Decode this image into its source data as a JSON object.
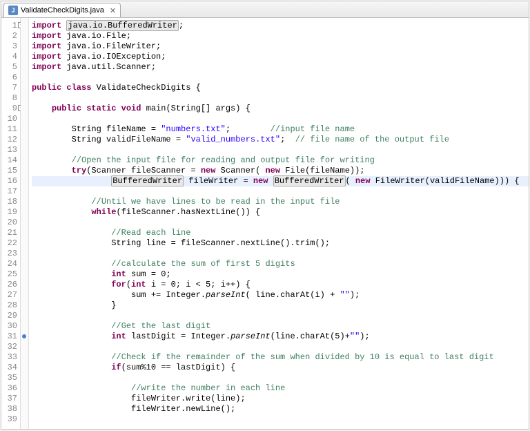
{
  "tab": {
    "icon_letter": "J",
    "title": "ValidateCheckDigits.java",
    "close": "✕"
  },
  "gutter": {
    "start": 1,
    "end": 39,
    "folds": [
      1,
      9
    ],
    "markers_blue": [
      31
    ]
  },
  "code": [
    {
      "n": 1,
      "seg": [
        {
          "c": "kw",
          "t": "import"
        },
        {
          "t": " "
        },
        {
          "c": "sel-box",
          "t": "java.io.BufferedWriter"
        },
        {
          "t": ";"
        }
      ]
    },
    {
      "n": 2,
      "seg": [
        {
          "c": "kw",
          "t": "import"
        },
        {
          "t": " java.io.File;"
        }
      ]
    },
    {
      "n": 3,
      "seg": [
        {
          "c": "kw",
          "t": "import"
        },
        {
          "t": " java.io.FileWriter;"
        }
      ]
    },
    {
      "n": 4,
      "seg": [
        {
          "c": "kw",
          "t": "import"
        },
        {
          "t": " java.io.IOException;"
        }
      ]
    },
    {
      "n": 5,
      "seg": [
        {
          "c": "kw",
          "t": "import"
        },
        {
          "t": " java.util.Scanner;"
        }
      ]
    },
    {
      "n": 6,
      "seg": [
        {
          "t": ""
        }
      ]
    },
    {
      "n": 7,
      "seg": [
        {
          "c": "kw",
          "t": "public class"
        },
        {
          "t": " ValidateCheckDigits {"
        }
      ]
    },
    {
      "n": 8,
      "seg": [
        {
          "t": ""
        }
      ]
    },
    {
      "n": 9,
      "seg": [
        {
          "t": "    "
        },
        {
          "c": "kw",
          "t": "public static void"
        },
        {
          "t": " main(String[] args) {"
        }
      ]
    },
    {
      "n": 10,
      "seg": [
        {
          "t": ""
        }
      ]
    },
    {
      "n": 11,
      "seg": [
        {
          "t": "        String fileName = "
        },
        {
          "c": "str",
          "t": "\"numbers.txt\""
        },
        {
          "t": ";        "
        },
        {
          "c": "cmt",
          "t": "//input file name"
        }
      ]
    },
    {
      "n": 12,
      "seg": [
        {
          "t": "        String validFileName = "
        },
        {
          "c": "str",
          "t": "\"valid_numbers.txt\""
        },
        {
          "t": ";  "
        },
        {
          "c": "cmt",
          "t": "// file name of the output file"
        }
      ]
    },
    {
      "n": 13,
      "seg": [
        {
          "t": ""
        }
      ]
    },
    {
      "n": 14,
      "seg": [
        {
          "t": "        "
        },
        {
          "c": "cmt",
          "t": "//Open the input file for reading and output file for writing"
        }
      ]
    },
    {
      "n": 15,
      "seg": [
        {
          "t": "        "
        },
        {
          "c": "kw",
          "t": "try"
        },
        {
          "t": "(Scanner fileScanner = "
        },
        {
          "c": "kw",
          "t": "new"
        },
        {
          "t": " Scanner( "
        },
        {
          "c": "kw",
          "t": "new"
        },
        {
          "t": " File(fileName));"
        }
      ]
    },
    {
      "n": 16,
      "hl": true,
      "seg": [
        {
          "t": "                "
        },
        {
          "c": "sel-box",
          "t": "BufferedWriter"
        },
        {
          "t": " fileWriter = "
        },
        {
          "c": "kw",
          "t": "new"
        },
        {
          "t": " "
        },
        {
          "c": "sel-box",
          "t": "BufferedWriter"
        },
        {
          "t": "( "
        },
        {
          "c": "kw",
          "t": "new"
        },
        {
          "t": " FileWriter(validFileName))) {"
        }
      ]
    },
    {
      "n": 17,
      "seg": [
        {
          "t": ""
        }
      ]
    },
    {
      "n": 18,
      "seg": [
        {
          "t": "            "
        },
        {
          "c": "cmt",
          "t": "//Until we have lines to be read in the input file"
        }
      ]
    },
    {
      "n": 19,
      "seg": [
        {
          "t": "            "
        },
        {
          "c": "kw",
          "t": "while"
        },
        {
          "t": "(fileScanner.hasNextLine()) {"
        }
      ]
    },
    {
      "n": 20,
      "seg": [
        {
          "t": ""
        }
      ]
    },
    {
      "n": 21,
      "seg": [
        {
          "t": "                "
        },
        {
          "c": "cmt",
          "t": "//Read each line"
        }
      ]
    },
    {
      "n": 22,
      "seg": [
        {
          "t": "                String line = fileScanner.nextLine().trim();"
        }
      ]
    },
    {
      "n": 23,
      "seg": [
        {
          "t": ""
        }
      ]
    },
    {
      "n": 24,
      "seg": [
        {
          "t": "                "
        },
        {
          "c": "cmt",
          "t": "//calculate the sum of first 5 digits"
        }
      ]
    },
    {
      "n": 25,
      "seg": [
        {
          "t": "                "
        },
        {
          "c": "kw",
          "t": "int"
        },
        {
          "t": " sum = 0;"
        }
      ]
    },
    {
      "n": 26,
      "seg": [
        {
          "t": "                "
        },
        {
          "c": "kw",
          "t": "for"
        },
        {
          "t": "("
        },
        {
          "c": "kw",
          "t": "int"
        },
        {
          "t": " i = 0; i < 5; i++) {"
        }
      ]
    },
    {
      "n": 27,
      "seg": [
        {
          "t": "                    sum += Integer."
        },
        {
          "c": "italic",
          "t": "parseInt"
        },
        {
          "t": "( line.charAt(i) + "
        },
        {
          "c": "str",
          "t": "\"\""
        },
        {
          "t": ");"
        }
      ]
    },
    {
      "n": 28,
      "seg": [
        {
          "t": "                }"
        }
      ]
    },
    {
      "n": 29,
      "seg": [
        {
          "t": ""
        }
      ]
    },
    {
      "n": 30,
      "seg": [
        {
          "t": "                "
        },
        {
          "c": "cmt",
          "t": "//Get the last digit"
        }
      ]
    },
    {
      "n": 31,
      "seg": [
        {
          "t": "                "
        },
        {
          "c": "kw",
          "t": "int"
        },
        {
          "t": " lastDigit = Integer."
        },
        {
          "c": "italic",
          "t": "parseInt"
        },
        {
          "t": "(line.charAt(5)+"
        },
        {
          "c": "str",
          "t": "\"\""
        },
        {
          "t": ");"
        }
      ]
    },
    {
      "n": 32,
      "seg": [
        {
          "t": ""
        }
      ]
    },
    {
      "n": 33,
      "seg": [
        {
          "t": "                "
        },
        {
          "c": "cmt",
          "t": "//Check if the remainder of the sum when divided by 10 is equal to last digit"
        }
      ]
    },
    {
      "n": 34,
      "seg": [
        {
          "t": "                "
        },
        {
          "c": "kw",
          "t": "if"
        },
        {
          "t": "(sum%10 == lastDigit) {"
        }
      ]
    },
    {
      "n": 35,
      "seg": [
        {
          "t": ""
        }
      ]
    },
    {
      "n": 36,
      "seg": [
        {
          "t": "                    "
        },
        {
          "c": "cmt",
          "t": "//write the number in each line"
        }
      ]
    },
    {
      "n": 37,
      "seg": [
        {
          "t": "                    fileWriter.write(line);"
        }
      ]
    },
    {
      "n": 38,
      "seg": [
        {
          "t": "                    fileWriter.newLine();"
        }
      ]
    },
    {
      "n": 39,
      "seg": [
        {
          "t": ""
        }
      ]
    }
  ]
}
